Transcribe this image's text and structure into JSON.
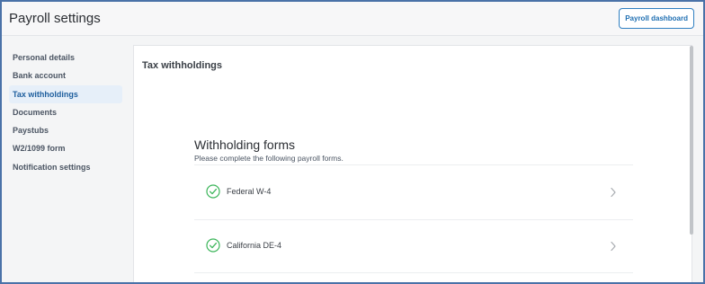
{
  "header": {
    "title": "Payroll settings",
    "dashboard_button": "Payroll dashboard"
  },
  "sidebar": {
    "items": [
      {
        "label": "Personal details",
        "active": false
      },
      {
        "label": "Bank account",
        "active": false
      },
      {
        "label": "Tax withholdings",
        "active": true
      },
      {
        "label": "Documents",
        "active": false
      },
      {
        "label": "Paystubs",
        "active": false
      },
      {
        "label": "W2/1099 form",
        "active": false
      },
      {
        "label": "Notification settings",
        "active": false
      }
    ]
  },
  "main": {
    "panel_title": "Tax withholdings",
    "section_title": "Withholding forms",
    "section_subtitle": "Please complete the following payroll forms.",
    "forms": [
      {
        "label": "Federal W-4",
        "status_icon": "check-circle-icon",
        "completed": true
      },
      {
        "label": "California DE-4",
        "status_icon": "check-circle-icon",
        "completed": true
      }
    ]
  },
  "colors": {
    "accent": "#1f6fb2",
    "active_bg": "#e6eff9",
    "check_green": "#3cb55a",
    "frame_border": "#4a72a8"
  }
}
